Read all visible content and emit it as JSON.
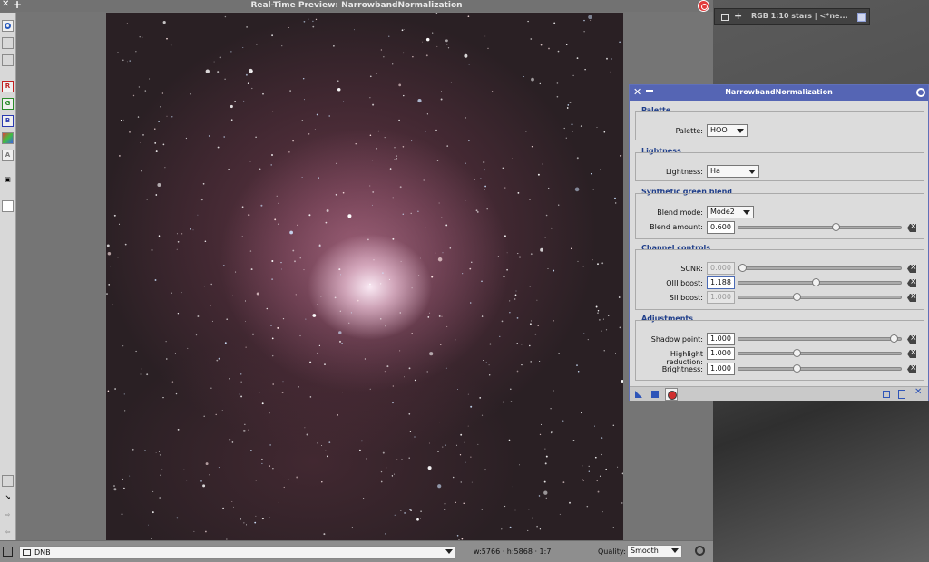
{
  "preview": {
    "title": "Real-Time Preview: NarrowbandNormalization",
    "toolbar_letters": {
      "r": "R",
      "g": "G",
      "b": "B",
      "a": "A"
    }
  },
  "mini_window": {
    "title": "RGB 1:10 stars | <*ne..."
  },
  "status": {
    "view_name": "DNB",
    "dims": "w:5766 · h:5868 · 1:7",
    "quality_label": "Quality:",
    "quality_value": "Smooth"
  },
  "dialog": {
    "title": "NarrowbandNormalization",
    "palette": {
      "group": "Palette",
      "label": "Palette:",
      "value": "HOO"
    },
    "lightness": {
      "group": "Lightness",
      "label": "Lightness:",
      "value": "Ha"
    },
    "green": {
      "group": "Synthetic green blend",
      "mode_label": "Blend mode:",
      "mode_value": "Mode2",
      "amount_label": "Blend amount:",
      "amount_value": "0.600",
      "amount_level": 0.6
    },
    "channel": {
      "group": "Channel controls",
      "scnr_label": "SCNR:",
      "scnr_value": "0.000",
      "scnr_level": 0.0,
      "oiii_label": "OIII boost:",
      "oiii_value": "1.188",
      "oiii_level": 0.47,
      "sii_label": "SII boost:",
      "sii_value": "1.000",
      "sii_level": 0.35
    },
    "adjust": {
      "group": "Adjustments",
      "shadow_label": "Shadow point:",
      "shadow_value": "1.000",
      "shadow_level": 0.97,
      "highlight_label": "Highlight reduction:",
      "highlight_value": "1.000",
      "highlight_level": 0.35,
      "bright_label": "Brightness:",
      "bright_value": "1.000",
      "bright_level": 0.35
    }
  }
}
